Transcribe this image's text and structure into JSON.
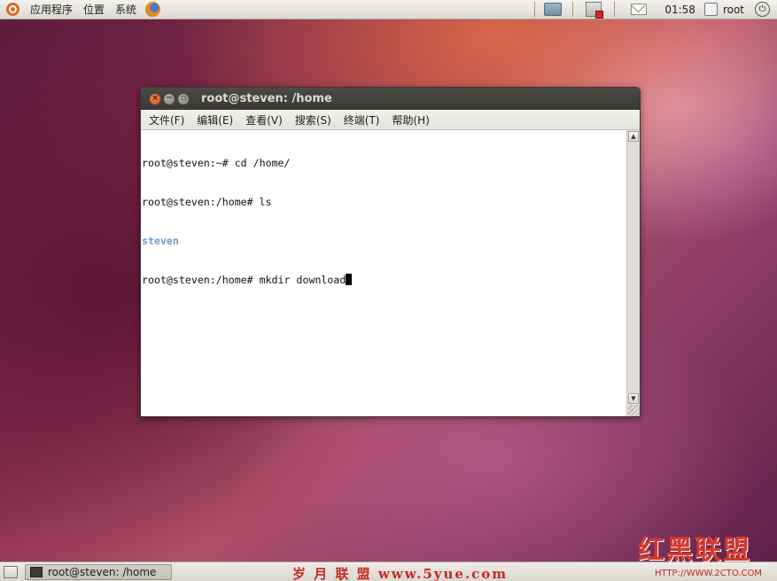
{
  "top_panel": {
    "menus": [
      "应用程序",
      "位置",
      "系统"
    ],
    "clock": "01:58",
    "user": "root"
  },
  "window": {
    "title": "root@steven: /home",
    "menu": [
      "文件(F)",
      "编辑(E)",
      "查看(V)",
      "搜索(S)",
      "终端(T)",
      "帮助(H)"
    ],
    "terminal_lines": [
      {
        "text": "root@steven:~# cd /home/"
      },
      {
        "text": "root@steven:/home# ls"
      },
      {
        "text": "steven"
      },
      {
        "text": "root@steven:/home# mkdir download"
      }
    ]
  },
  "bottom_panel": {
    "task_label": "root@steven: /home"
  },
  "watermarks": {
    "site1": "岁 月 联 盟  www.5yue.com",
    "site2_logo": "红黑联盟",
    "site2_url": "HTTP://WWW.2CTO.COM"
  },
  "colors": {
    "terminal_dir": "#6f9fc9",
    "close_button": "#d84a15"
  }
}
